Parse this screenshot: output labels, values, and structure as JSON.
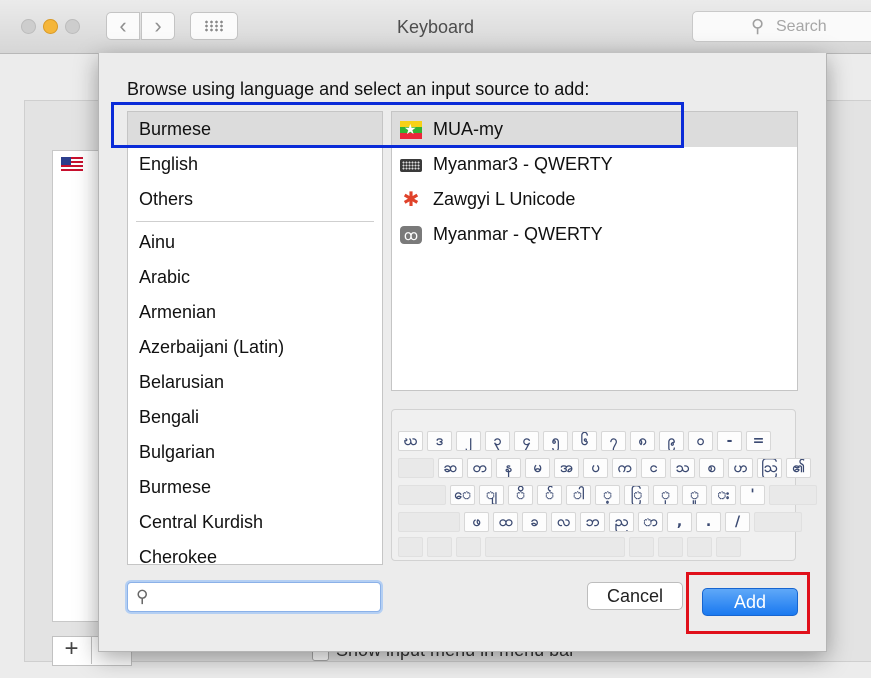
{
  "window": {
    "title": "Keyboard",
    "search_placeholder": "Search"
  },
  "background": {
    "show_input_menu_label": "Show input menu in menu bar",
    "plus_label": "+"
  },
  "sheet": {
    "prompt": "Browse using language and select an input source to add:",
    "languages_top": [
      "Burmese",
      "English",
      "Others"
    ],
    "languages_all": [
      "Ainu",
      "Arabic",
      "Armenian",
      "Azerbaijani (Latin)",
      "Belarusian",
      "Bengali",
      "Bulgarian",
      "Burmese",
      "Central Kurdish",
      "Cherokee"
    ],
    "selected_language": "Burmese",
    "input_sources": [
      {
        "label": "MUA-my",
        "icon": "myanmar-flag-icon"
      },
      {
        "label": "Myanmar3 - QWERTY",
        "icon": "keyboard-icon"
      },
      {
        "label": "Zawgyi L Unicode",
        "icon": "zawgyi-figure-icon"
      },
      {
        "label": "Myanmar - QWERTY",
        "icon": "myanmar-letter-icon"
      }
    ],
    "selected_source": "MUA-my",
    "keyboard_rows": [
      [
        "ဃ",
        "ဒ",
        "၂",
        "၃",
        "၄",
        "၅",
        "၆",
        "၇",
        "၈",
        "၉",
        "၀",
        "-",
        "="
      ],
      [
        "ဆ",
        "တ",
        "န",
        "မ",
        "အ",
        "ပ",
        "က",
        "င",
        "သ",
        "စ",
        "ဟ",
        "ဩ",
        "၏"
      ],
      [
        "ေ",
        "ျ",
        "ိ",
        "်",
        "ါ",
        "့",
        "ြ",
        "ု",
        "ူ",
        "း",
        "'"
      ],
      [
        "ဖ",
        "ထ",
        "ခ",
        "လ",
        "ဘ",
        "ည",
        "ာ",
        ",",
        ".",
        "/"
      ]
    ],
    "cancel_label": "Cancel",
    "add_label": "Add"
  },
  "colors": {
    "accent": "#1a79f0",
    "highlight_blue": "#0a2bd8",
    "highlight_red": "#e0101a"
  }
}
